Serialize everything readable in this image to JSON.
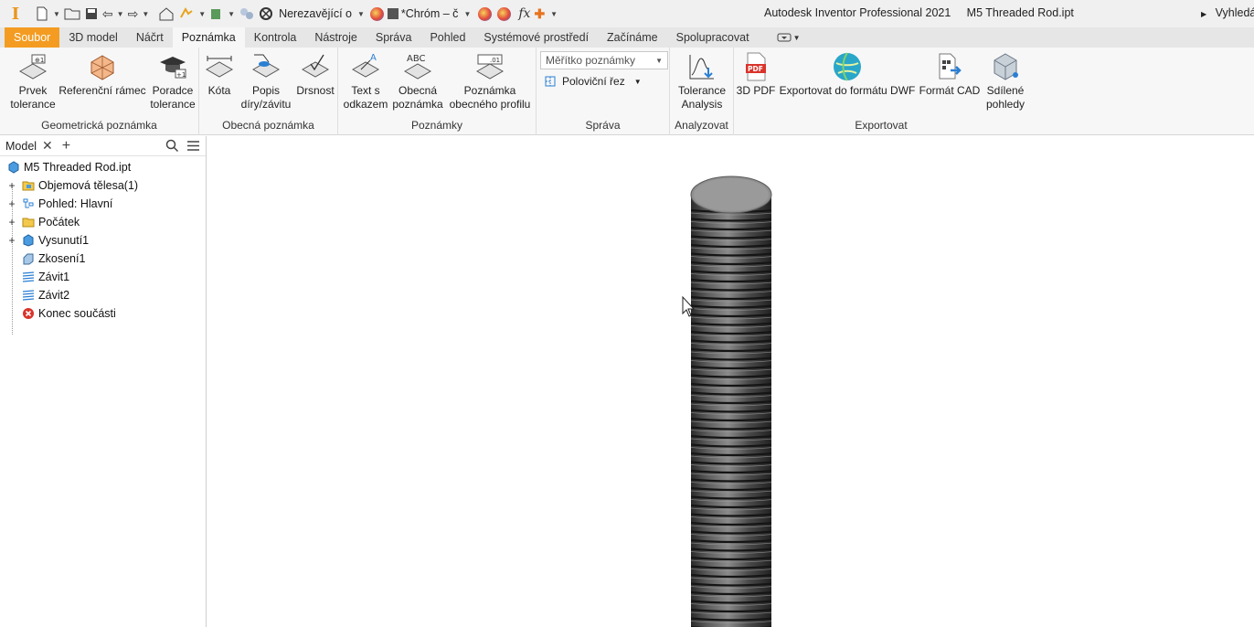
{
  "app": {
    "title": "Autodesk Inventor Professional 2021",
    "document": "M5 Threaded Rod.ipt",
    "search_label": "Vyhledá"
  },
  "qat": {
    "material_combo": "Nerezavějící o",
    "appearance_combo": "*Chróm – č"
  },
  "tabs": [
    {
      "label": "Soubor"
    },
    {
      "label": "3D model"
    },
    {
      "label": "Náčrt"
    },
    {
      "label": "Poznámka"
    },
    {
      "label": "Kontrola"
    },
    {
      "label": "Nástroje"
    },
    {
      "label": "Správa"
    },
    {
      "label": "Pohled"
    },
    {
      "label": "Systémové prostředí"
    },
    {
      "label": "Začínáme"
    },
    {
      "label": "Spolupracovat"
    }
  ],
  "active_tab_index": 3,
  "ribbon": {
    "geometric": {
      "title": "Geometrická poznámka",
      "feature_tolerance": [
        "Prvek",
        "tolerance"
      ],
      "datum_frame": "Referenční rámec",
      "tolerance_advisor": [
        "Poradce",
        "tolerance"
      ]
    },
    "general": {
      "title": "Obecná poznámka",
      "dimension": "Kóta",
      "hole_thread": [
        "Popis",
        "díry/závitu"
      ],
      "roughness": "Drsnost"
    },
    "notes": {
      "title": "Poznámky",
      "leader_text": [
        "Text s",
        "odkazem"
      ],
      "general_note": [
        "Obecná",
        "poznámka"
      ],
      "profile_note": [
        "Poznámka",
        "obecného profilu"
      ]
    },
    "manage": {
      "title": "Správa",
      "scale_placeholder": "Měřítko poznámky",
      "half_section": "Poloviční řez"
    },
    "analyze": {
      "title": "Analyzovat",
      "tolerance_analysis": [
        "Tolerance",
        "Analysis"
      ]
    },
    "export": {
      "title": "Exportovat",
      "pdf": "3D PDF",
      "dwf": "Exportovat do formátu DWF",
      "cad": "Formát CAD",
      "shared": [
        "Sdílené",
        "pohledy"
      ]
    }
  },
  "browser": {
    "tab_label": "Model",
    "root": "M5 Threaded Rod.ipt",
    "nodes": [
      {
        "label": "Objemová tělesa(1)",
        "expandable": true
      },
      {
        "label": "Pohled: Hlavní",
        "expandable": true
      },
      {
        "label": "Počátek",
        "expandable": true
      },
      {
        "label": "Vysunutí1",
        "expandable": true
      },
      {
        "label": "Zkosení1",
        "expandable": false
      },
      {
        "label": "Závit1",
        "expandable": false
      },
      {
        "label": "Závit2",
        "expandable": false
      },
      {
        "label": "Konec součásti",
        "expandable": false
      }
    ]
  },
  "colors": {
    "file_tab": "#f39c21",
    "accent_blue": "#2a7fd4",
    "end_of_part": "#d9342b"
  }
}
